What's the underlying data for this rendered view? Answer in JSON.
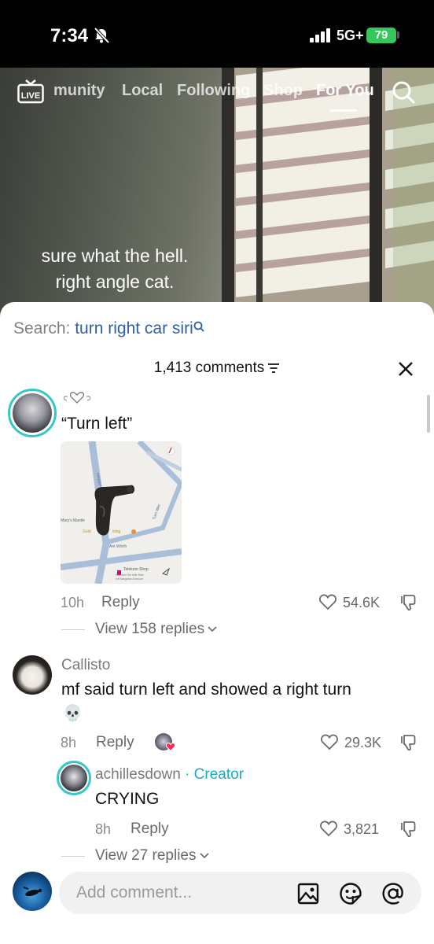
{
  "status_bar": {
    "time": "7:34",
    "network": "5G+",
    "battery": "79"
  },
  "nav": {
    "tabs": [
      {
        "label": "munity"
      },
      {
        "label": "Local"
      },
      {
        "label": "Following"
      },
      {
        "label": "Shop"
      },
      {
        "label": "For You",
        "active": true
      }
    ],
    "live_label": "LIVE"
  },
  "video": {
    "caption_line1": "sure what the hell.",
    "caption_line2": "right angle cat."
  },
  "comments_panel": {
    "search_label": "Search:",
    "search_query": "turn right car siri",
    "count_label": "1,413 comments",
    "comments": [
      {
        "text": "“Turn left”",
        "time": "10h",
        "reply_label": "Reply",
        "likes": "54.6K",
        "view_replies": "View 158 replies",
        "map": {
          "labels": [
            "Mary's Mantle",
            "Gold",
            "ising",
            "Turn Wet",
            "Am Wörth",
            "Telekom Shop",
            "Kommen Sie bitte Netz",
            "mit Margarita Zuhause",
            "nseppel",
            "Am Wörth"
          ]
        }
      },
      {
        "username": "Callisto",
        "text": "mf said turn left and showed a right turn",
        "emoji": "💀",
        "time": "8h",
        "reply_label": "Reply",
        "likes": "29.3K",
        "replies": [
          {
            "username": "achillesdown",
            "creator_tag": "· Creator",
            "text": "CRYING",
            "time": "8h",
            "reply_label": "Reply",
            "likes": "3,821"
          }
        ],
        "view_replies": "View 27 replies"
      }
    ]
  },
  "input": {
    "placeholder": "Add comment..."
  },
  "colors": {
    "accent_link": "#2f5ea8",
    "creator": "#1aa9c9",
    "battery": "#34c759",
    "avatar_ring": "#34c7c7"
  }
}
